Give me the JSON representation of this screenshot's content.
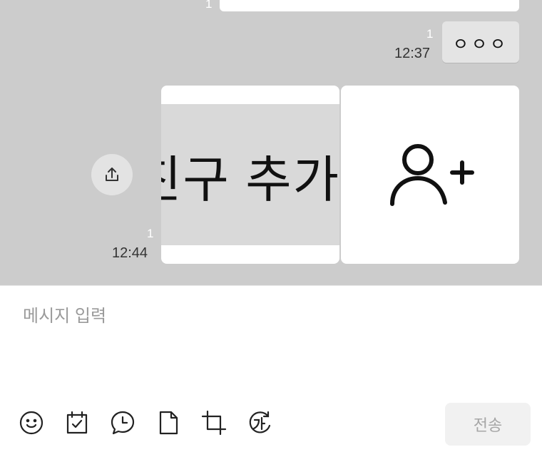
{
  "chat": {
    "previous": {
      "unread": "1"
    },
    "message1": {
      "text": "ㅇㅇㅇ",
      "unread": "1",
      "time": "12:37"
    },
    "message2": {
      "unread": "1",
      "time": "12:44",
      "banner_text": "친구 추가",
      "icon": "add-friend-icon"
    }
  },
  "composer": {
    "placeholder": "메시지 입력",
    "send_label": "전송",
    "toolbar": [
      "emoticon-icon",
      "calendar-check-icon",
      "schedule-message-icon",
      "file-icon",
      "capture-icon",
      "spell-check-icon"
    ]
  },
  "colors": {
    "chat_background": "#cccccc",
    "bubble_other": "#e4e4e4",
    "composer_background": "#ffffff",
    "send_disabled": "#f1f1f1"
  }
}
